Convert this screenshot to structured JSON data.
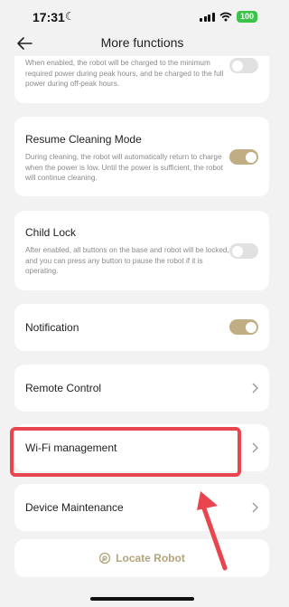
{
  "status_bar": {
    "time": "17:31",
    "battery": "100"
  },
  "header": {
    "title": "More functions"
  },
  "settings": {
    "peak_shift": {
      "description": "When enabled, the robot will be charged to the minimum required power during peak hours, and be charged to the full power during off-peak hours.",
      "enabled": false
    },
    "resume_cleaning": {
      "title": "Resume Cleaning Mode",
      "description": "During cleaning, the robot will automatically return to charge when the power is low. Until the power is sufficient, the robot will continue cleaning.",
      "enabled": true
    },
    "child_lock": {
      "title": "Child Lock",
      "description": "After enabled, all buttons on the base and robot will be locked, and you can press any button to pause the robot if it is operating.",
      "enabled": false
    },
    "notification": {
      "title": "Notification",
      "enabled": true
    }
  },
  "nav_items": {
    "remote_control": "Remote Control",
    "wifi_management": "Wi-Fi management",
    "device_maintenance": "Device Maintenance"
  },
  "locate": {
    "label": "Locate Robot"
  },
  "colors": {
    "accent": "#c1ad84",
    "annotation": "#e8454f",
    "toggle_off": "#e1e1e1"
  }
}
